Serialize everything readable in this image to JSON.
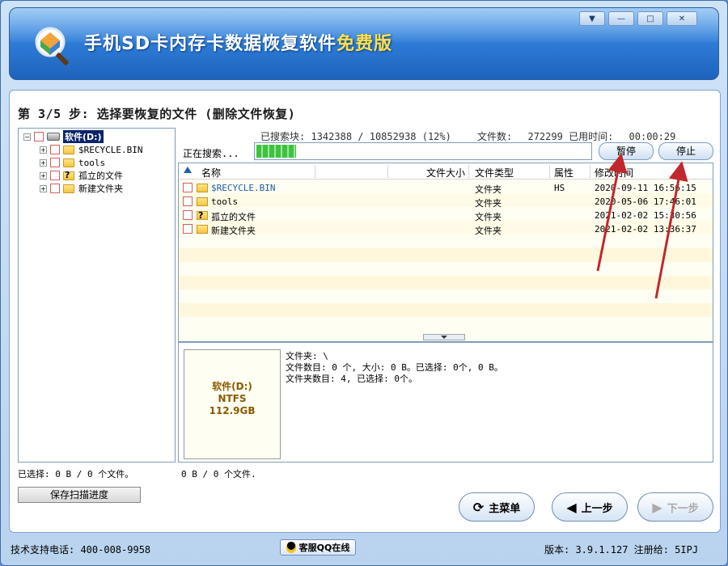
{
  "app": {
    "title_main": "手机SD卡内存卡数据恢复软件",
    "title_free": "免费版",
    "window_buttons": [
      "▼",
      "—",
      "□",
      "✕"
    ]
  },
  "step": {
    "title": "第 3/5 步: 选择要恢复的文件 (删除文件恢复)"
  },
  "tree": {
    "root": "软件(D:)",
    "items": [
      "$RECYCLE.BIN",
      "tools",
      "孤立的文件",
      "新建文件夹"
    ]
  },
  "scan": {
    "blocks_label": "已搜索块:",
    "blocks_value": "1342388 / 10852938 (12%)",
    "files_label": "文件数:",
    "files_value": "272299",
    "time_label": "已用时间:",
    "time_value": "00:00:29",
    "searching_label": "正在搜索...",
    "progress": 0.12,
    "pause_label": "暂停",
    "stop_label": "停止"
  },
  "filelist": {
    "columns": [
      "名称",
      "文件大小",
      "文件类型",
      "属性",
      "修改时间"
    ],
    "rows": [
      {
        "name": "$RECYCLE.BIN",
        "size": "",
        "type": "文件夹",
        "attr": "HS",
        "time": "2020-09-11 16:56:15"
      },
      {
        "name": "tools",
        "size": "",
        "type": "文件夹",
        "attr": "",
        "time": "2020-05-06 17:46:01"
      },
      {
        "name": "孤立的文件",
        "size": "",
        "type": "文件夹",
        "attr": "",
        "time": "2021-02-02 15:30:56"
      },
      {
        "name": "新建文件夹",
        "size": "",
        "type": "文件夹",
        "attr": "",
        "time": "2021-02-02 13:36:37"
      }
    ]
  },
  "info": {
    "drive_name": "软件(D:)",
    "fs": "NTFS",
    "size": "112.9GB",
    "line1": "文件夹: \\",
    "line2": "文件数目: 0 个, 大小: 0 B。已选择: 0个, 0 B。",
    "line3": "文件夹数目: 4, 已选择: 0个。"
  },
  "status": {
    "left": "已选择: 0 B / 0 个文件。",
    "mid": "0 B / 0 个文件."
  },
  "buttons": {
    "save_progress": "保存扫描进度",
    "main_menu": "主菜单",
    "prev": "上一步",
    "next": "下一步"
  },
  "footer": {
    "support": "技术支持电话: 400-008-9958",
    "qq": "客服QQ在线",
    "version": "版本: 3.9.1.127 注册给: 5IPJ"
  },
  "colors": {
    "accent": "#2f7ed8",
    "progress": "#3fc23f",
    "arrow": "#c0282d"
  }
}
